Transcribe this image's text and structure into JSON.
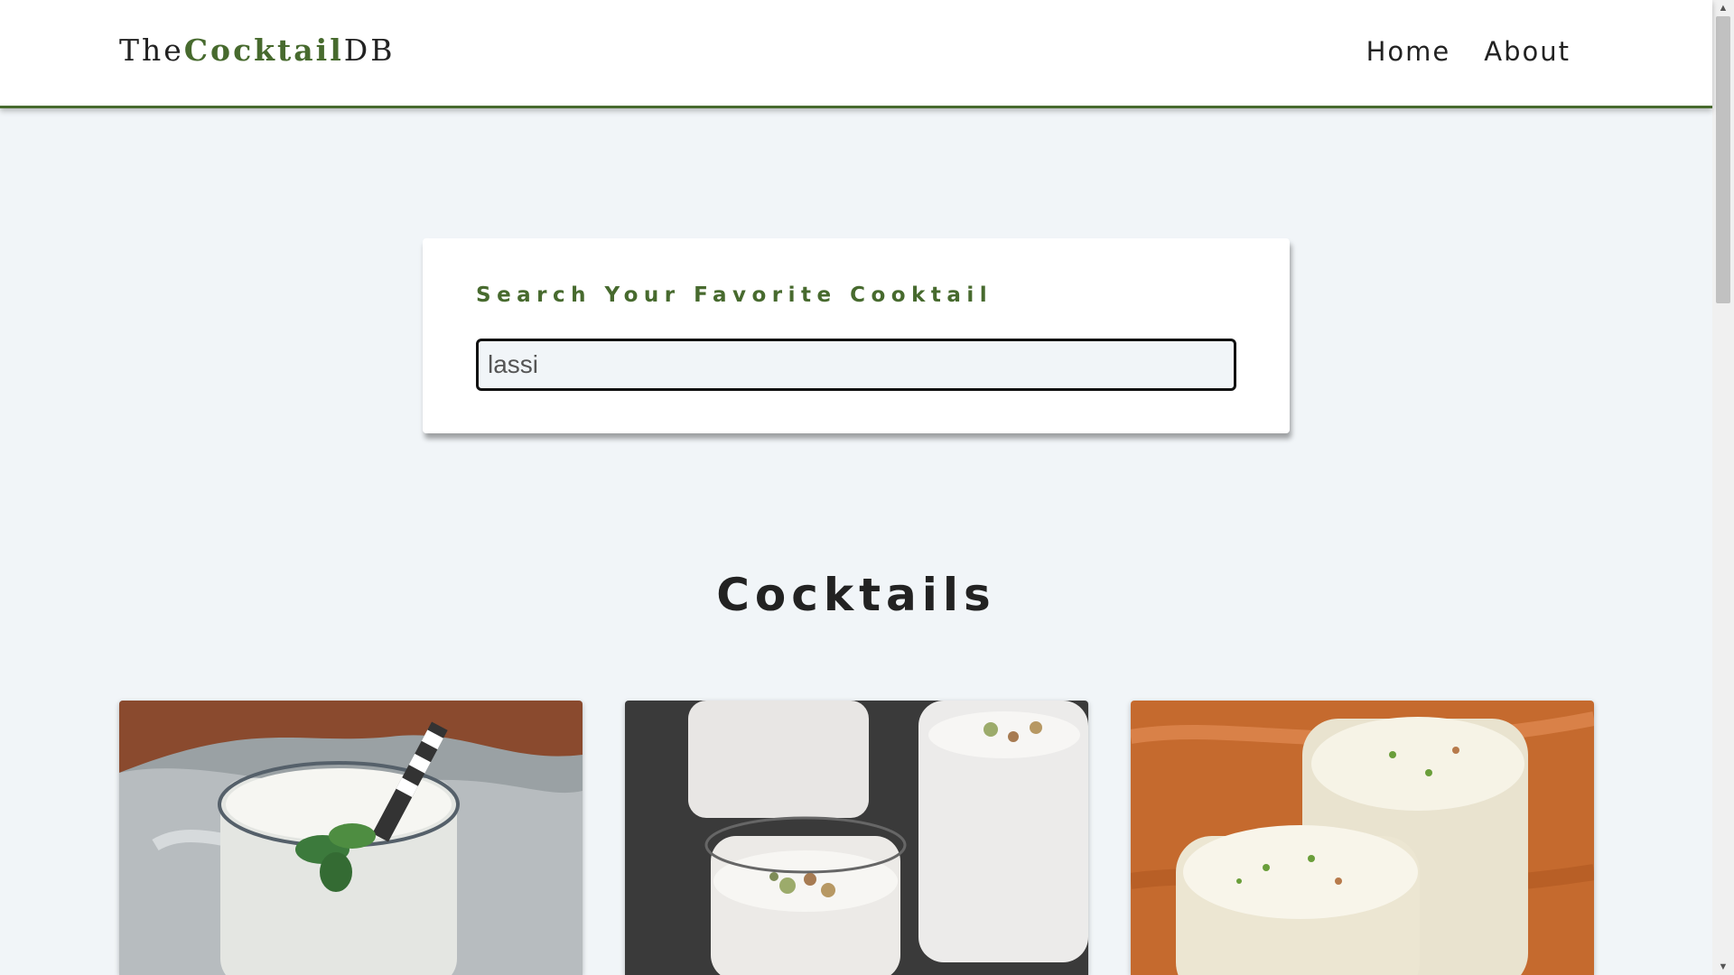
{
  "navbar": {
    "logo": {
      "prefix": "The",
      "accent": "Cocktail",
      "suffix": "DB"
    },
    "links": [
      {
        "label": "Home"
      },
      {
        "label": "About"
      }
    ]
  },
  "search": {
    "label": "Search Your Favorite Cooktail",
    "value": "lassi"
  },
  "results": {
    "title": "Cocktails",
    "cards": [
      {
        "image": "lassi-glass-with-mint-and-straw"
      },
      {
        "image": "lassi-glasses-with-pistachio-topping"
      },
      {
        "image": "lassi-glasses-with-herb-topping"
      }
    ]
  },
  "colors": {
    "accent": "#476a2e",
    "background": "#f1f5f8",
    "text": "#222222"
  }
}
